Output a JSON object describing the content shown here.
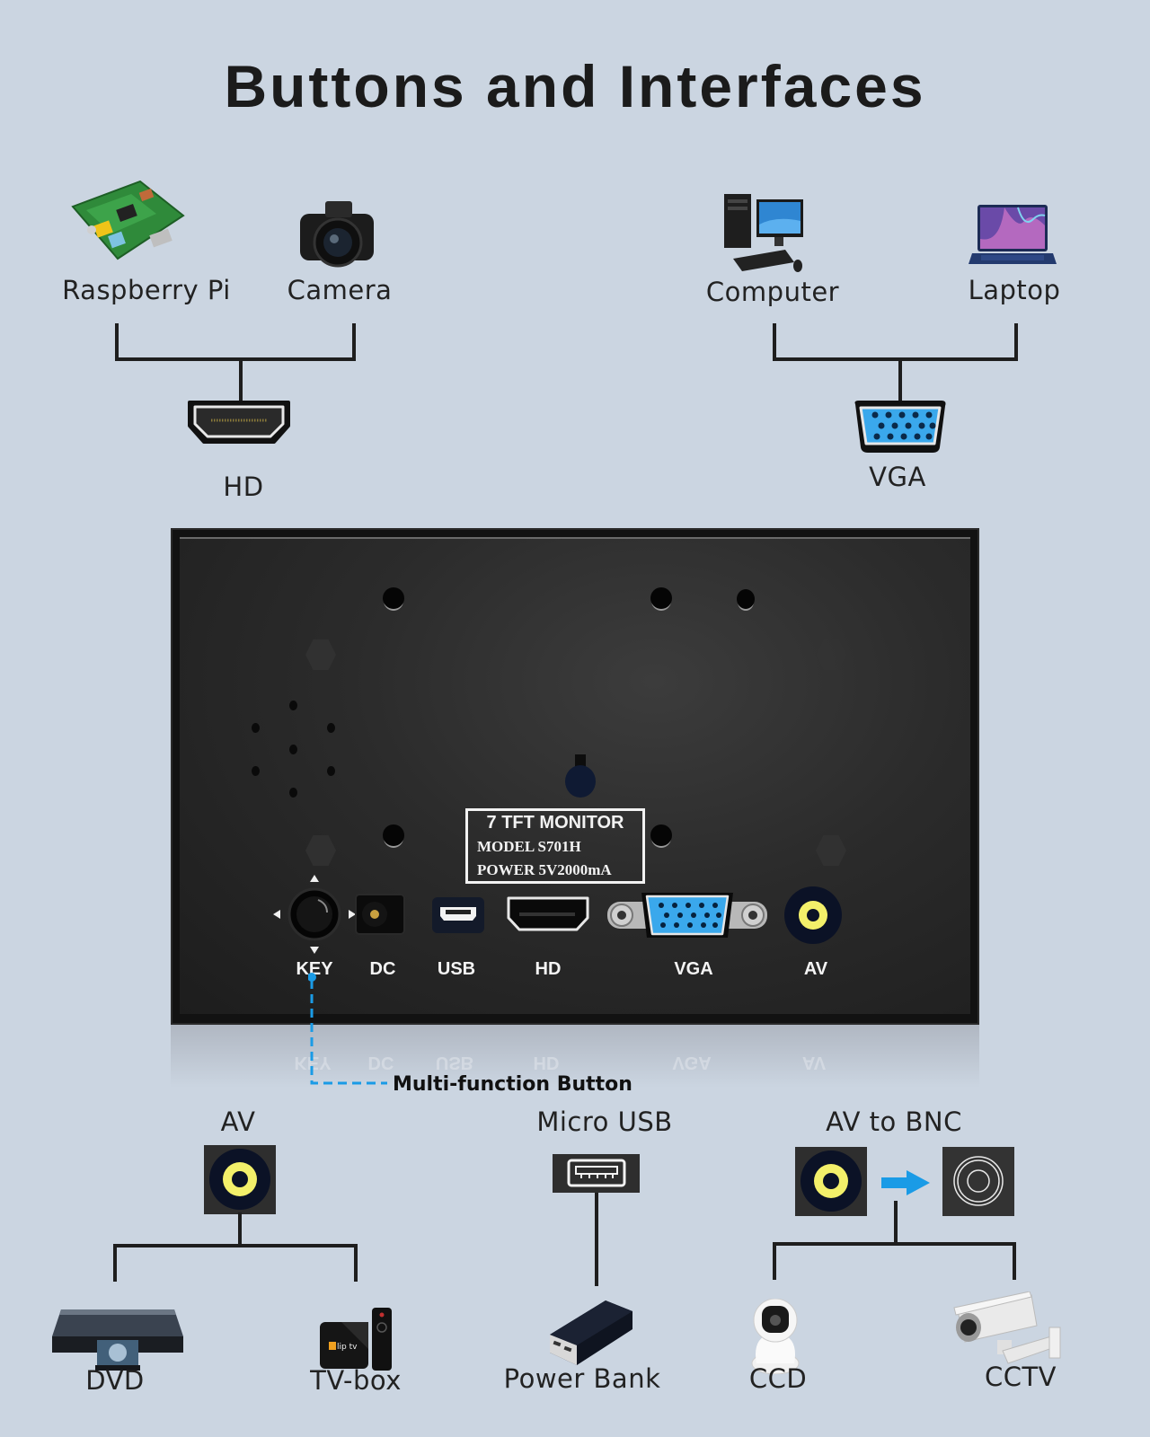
{
  "title": "Buttons and Interfaces",
  "top_left_group": {
    "devices": [
      {
        "label": "Raspberry Pi",
        "icon": "raspberry-pi-board-icon"
      },
      {
        "label": "Camera",
        "icon": "dslr-camera-icon"
      }
    ],
    "port": {
      "label": "HD",
      "icon": "hdmi-port-icon"
    }
  },
  "top_right_group": {
    "devices": [
      {
        "label": "Computer",
        "icon": "desktop-computer-icon"
      },
      {
        "label": "Laptop",
        "icon": "laptop-icon"
      }
    ],
    "port": {
      "label": "VGA",
      "icon": "vga-port-icon"
    }
  },
  "monitor": {
    "label_plate": {
      "line1": "7  TFT MONITOR",
      "line2": "MODEL  S701H",
      "line3": "POWER  5V2000mA"
    },
    "ports": [
      {
        "label": "KEY",
        "icon": "joystick-key-icon"
      },
      {
        "label": "DC",
        "icon": "dc-jack-icon"
      },
      {
        "label": "USB",
        "icon": "micro-usb-port-icon"
      },
      {
        "label": "HD",
        "icon": "hdmi-port-icon"
      },
      {
        "label": "VGA",
        "icon": "vga-port-icon"
      },
      {
        "label": "AV",
        "icon": "av-rca-port-icon"
      }
    ],
    "callout": "Multi-function Button",
    "callout_color": "#1a9be6"
  },
  "bottom_groups": [
    {
      "port": {
        "label": "AV",
        "icon": "av-rca-port-icon"
      },
      "devices": [
        {
          "label": "DVD",
          "icon": "dvd-player-icon"
        },
        {
          "label": "TV-box",
          "icon": "tv-box-icon"
        }
      ]
    },
    {
      "port": {
        "label": "Micro USB",
        "icon": "usb-port-icon"
      },
      "devices": [
        {
          "label": "Power Bank",
          "icon": "power-bank-icon"
        }
      ]
    },
    {
      "port": {
        "label": "AV to BNC",
        "icon": "av-to-bnc-icon"
      },
      "devices": [
        {
          "label": "CCD",
          "icon": "dome-camera-icon"
        },
        {
          "label": "CCTV",
          "icon": "cctv-camera-icon"
        }
      ]
    }
  ],
  "colors": {
    "background": "#cbd5e1",
    "accent_blue": "#1a9be6",
    "av_yellow": "#f3f06a",
    "vga_blue": "#3aa8ec"
  }
}
